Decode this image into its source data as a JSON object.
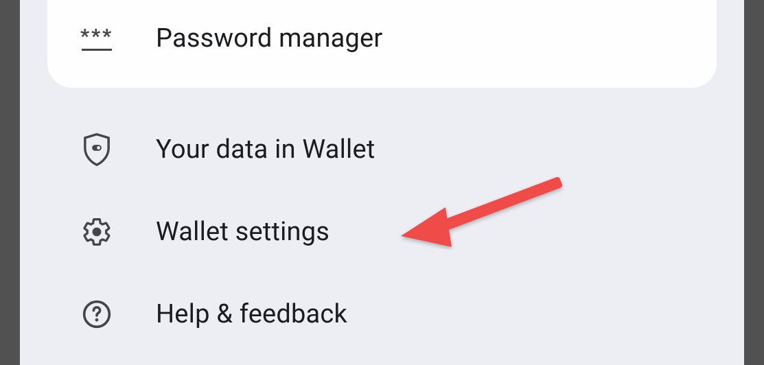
{
  "menu": {
    "items": [
      {
        "id": "password-manager",
        "label": "Password manager",
        "icon": "password-icon"
      },
      {
        "id": "your-data-in-wallet",
        "label": "Your data in Wallet",
        "icon": "shield-privacy-icon"
      },
      {
        "id": "wallet-settings",
        "label": "Wallet settings",
        "icon": "gear-icon"
      },
      {
        "id": "help-feedback",
        "label": "Help & feedback",
        "icon": "help-icon"
      }
    ]
  },
  "annotation": {
    "type": "arrow",
    "target": "wallet-settings",
    "color": "#ee4c4a"
  }
}
